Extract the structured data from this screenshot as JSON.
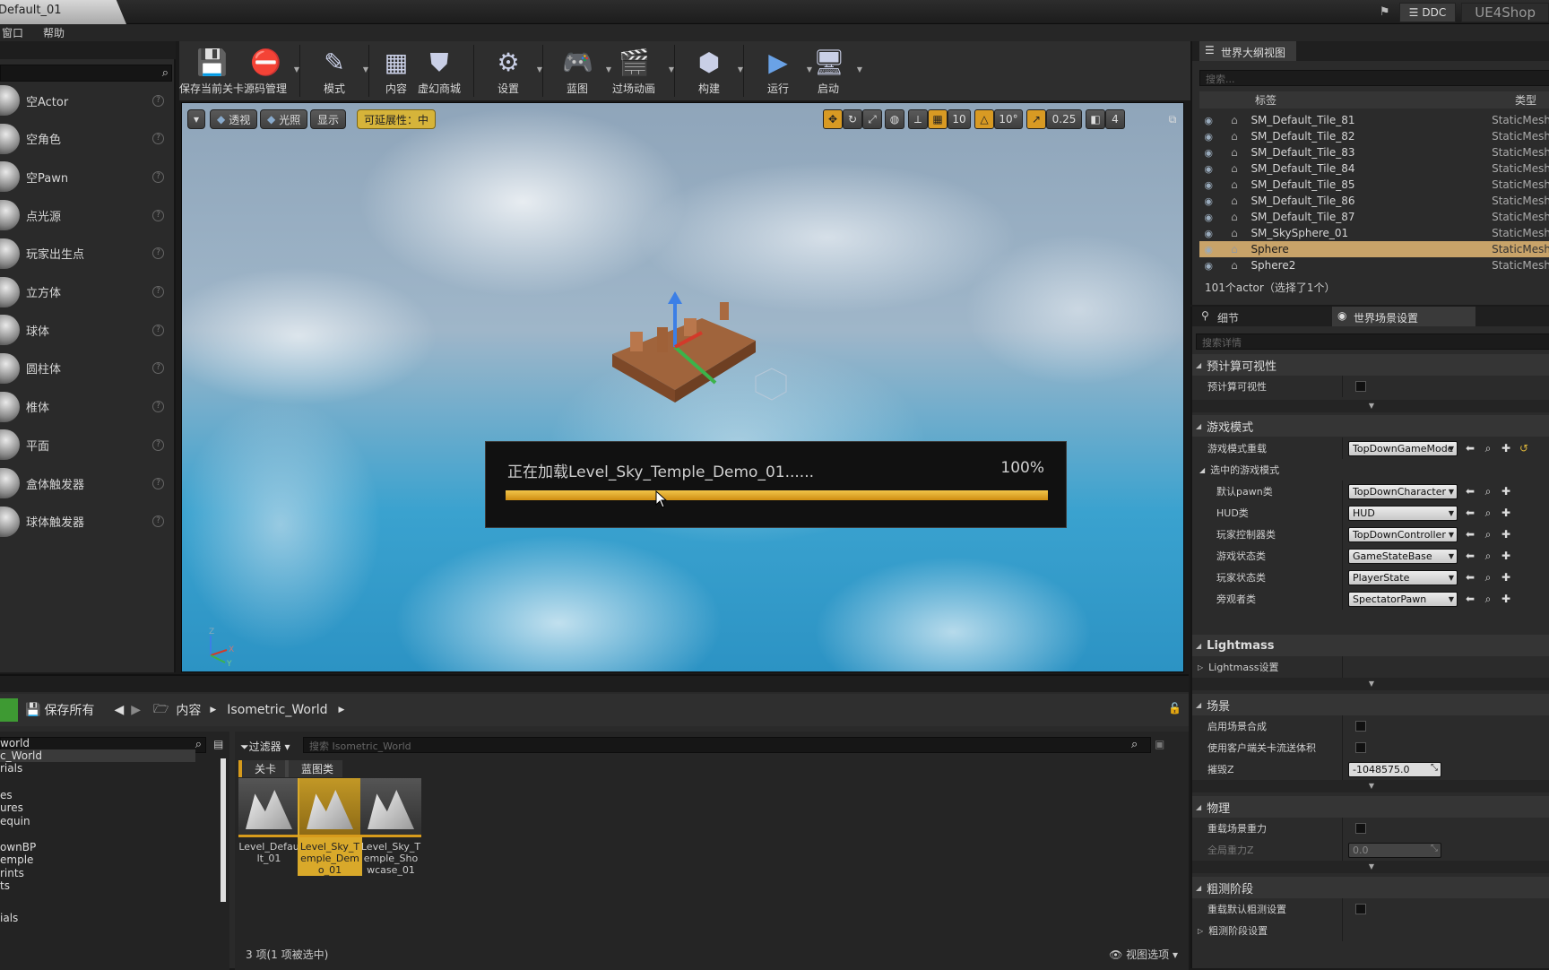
{
  "titlebar": {
    "doc_tab": "Default_01",
    "ddc": "DDC",
    "shop": "UE4Shop"
  },
  "menu": [
    "窗口",
    "帮助"
  ],
  "place_panel": {
    "items": [
      {
        "label": "空Actor",
        "icon": "sphere-icon"
      },
      {
        "label": "空角色",
        "icon": "character-icon"
      },
      {
        "label": "空Pawn",
        "icon": "pawn-icon"
      },
      {
        "label": "点光源",
        "icon": "light-icon"
      },
      {
        "label": "玩家出生点",
        "icon": "playerstart-icon"
      },
      {
        "label": "立方体",
        "icon": "cube-icon"
      },
      {
        "label": "球体",
        "icon": "sphere-icon"
      },
      {
        "label": "圆柱体",
        "icon": "cylinder-icon"
      },
      {
        "label": "椎体",
        "icon": "cone-icon"
      },
      {
        "label": "平面",
        "icon": "plane-icon"
      },
      {
        "label": "盒体触发器",
        "icon": "box-trigger-icon"
      },
      {
        "label": "球体触发器",
        "icon": "sphere-trigger-icon"
      }
    ]
  },
  "toolbar": {
    "tools": [
      {
        "label": "保存当前关卡",
        "icon": "save-icon"
      },
      {
        "label": "源码管理",
        "icon": "source-control-icon"
      },
      {
        "label": "模式",
        "icon": "modes-icon"
      },
      {
        "label": "内容",
        "icon": "content-icon"
      },
      {
        "label": "虚幻商城",
        "icon": "marketplace-icon"
      },
      {
        "label": "设置",
        "icon": "settings-icon"
      },
      {
        "label": "蓝图",
        "icon": "blueprint-icon"
      },
      {
        "label": "过场动画",
        "icon": "cinematics-icon"
      },
      {
        "label": "构建",
        "icon": "build-icon"
      },
      {
        "label": "运行",
        "icon": "play-icon"
      },
      {
        "label": "启动",
        "icon": "launch-icon"
      }
    ]
  },
  "viewport": {
    "perspective": "透视",
    "lighting": "光照",
    "show": "显示",
    "scalability": "可延展性：中",
    "grid_snap": "10",
    "rot_snap": "10°",
    "scale_snap": "0.25",
    "cam_speed": "4",
    "loading_text": "正在加载Level_Sky_Temple_Demo_01......",
    "loading_percent": "100%",
    "loading_progress": 1.0
  },
  "outliner": {
    "tab": "世界大纲视图",
    "search_placeholder": "搜索...",
    "col_label": "标签",
    "col_type": "类型",
    "rows": [
      {
        "name": "SM_Default_Tile_81",
        "type": "StaticMesh"
      },
      {
        "name": "SM_Default_Tile_82",
        "type": "StaticMesh"
      },
      {
        "name": "SM_Default_Tile_83",
        "type": "StaticMesh"
      },
      {
        "name": "SM_Default_Tile_84",
        "type": "StaticMesh"
      },
      {
        "name": "SM_Default_Tile_85",
        "type": "StaticMesh"
      },
      {
        "name": "SM_Default_Tile_86",
        "type": "StaticMesh"
      },
      {
        "name": "SM_Default_Tile_87",
        "type": "StaticMesh"
      },
      {
        "name": "SM_SkySphere_01",
        "type": "StaticMesh"
      },
      {
        "name": "Sphere",
        "type": "StaticMesh",
        "selected": true
      },
      {
        "name": "Sphere2",
        "type": "StaticMesh"
      }
    ],
    "count": "101个actor（选择了1个）"
  },
  "details": {
    "tab_details": "细节",
    "tab_world": "世界场景设置",
    "search_placeholder": "搜索详情",
    "precomputed": {
      "title": "预计算可视性",
      "row": "预计算可视性"
    },
    "gamemode": {
      "title": "游戏模式",
      "override_label": "游戏模式重载",
      "override_value": "TopDownGameMode",
      "selected_title": "选中的游戏模式",
      "rows": [
        {
          "label": "默认pawn类",
          "value": "TopDownCharacter"
        },
        {
          "label": "HUD类",
          "value": "HUD"
        },
        {
          "label": "玩家控制器类",
          "value": "TopDownController"
        },
        {
          "label": "游戏状态类",
          "value": "GameStateBase"
        },
        {
          "label": "玩家状态类",
          "value": "PlayerState"
        },
        {
          "label": "旁观者类",
          "value": "SpectatorPawn"
        }
      ]
    },
    "lightmass": {
      "title": "Lightmass",
      "row": "Lightmass设置"
    },
    "world": {
      "title": "场景",
      "rows": [
        "启用场景合成",
        "使用客户端关卡流送体积"
      ],
      "killz_label": "摧毁Z",
      "killz_value": "-1048575.0"
    },
    "physics": {
      "title": "物理",
      "override_gravity": "重载场景重力",
      "global_gravity": "全局重力Z",
      "global_gravity_value": "0.0"
    },
    "broadphase": {
      "title": "粗测阶段",
      "override": "重载默认粗测设置",
      "settings": "粗测阶段设置"
    }
  },
  "content_browser": {
    "save_all": "保存所有",
    "path_root": "内容",
    "path_folder": "Isometric_World",
    "filters": "过滤器",
    "search_placeholder": "搜索 Isometric_World",
    "chips": [
      "关卡",
      "蓝图类"
    ],
    "tree": [
      "world",
      "c_World",
      "rials",
      "es",
      "ures",
      "equin",
      "ownBP",
      "emple",
      "rints",
      "ts",
      "ials"
    ],
    "assets": [
      {
        "name": "Level_Default_01",
        "selected": false
      },
      {
        "name": "Level_Sky_Temple_Demo_01",
        "selected": true
      },
      {
        "name": "Level_Sky_Temple_Showcase_01",
        "selected": false
      }
    ],
    "status": "3 项(1 项被选中)",
    "view_options": "视图选项"
  },
  "colors": {
    "accent": "#d9a92a",
    "selection": "#c8a369",
    "progress": "#e8b235"
  }
}
